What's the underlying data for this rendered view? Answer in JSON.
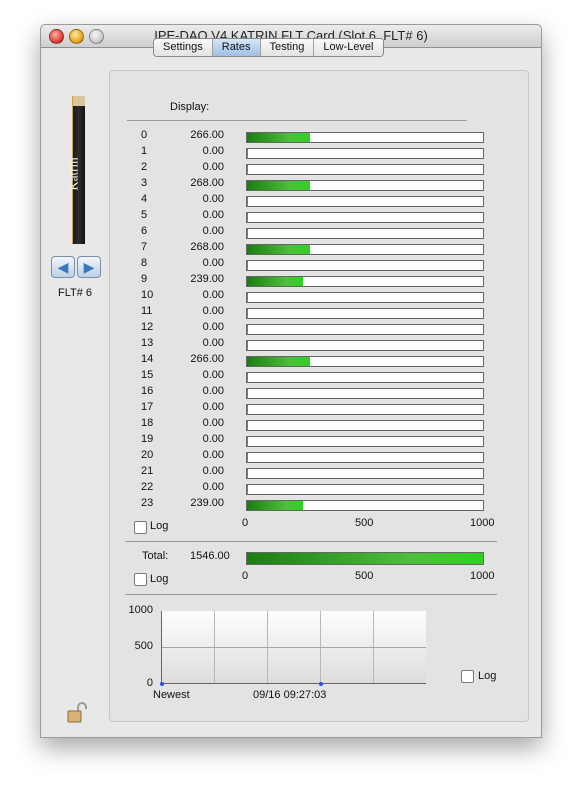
{
  "window": {
    "title": "IPE-DAQ V4 KATRIN FLT Card (Slot 6, FLT# 6)"
  },
  "left": {
    "card_text": "Katrin",
    "flt_label": "FLT# 6"
  },
  "tabs": [
    "Settings",
    "Rates",
    "Testing",
    "Low-Level"
  ],
  "active_tab": "Rates",
  "display_label": "Display:",
  "rate_scale_max": 1000,
  "channels": [
    {
      "ch": "0",
      "val": "266.00",
      "rate": 266
    },
    {
      "ch": "1",
      "val": "0.00",
      "rate": 0
    },
    {
      "ch": "2",
      "val": "0.00",
      "rate": 0
    },
    {
      "ch": "3",
      "val": "268.00",
      "rate": 268
    },
    {
      "ch": "4",
      "val": "0.00",
      "rate": 0
    },
    {
      "ch": "5",
      "val": "0.00",
      "rate": 0
    },
    {
      "ch": "6",
      "val": "0.00",
      "rate": 0
    },
    {
      "ch": "7",
      "val": "268.00",
      "rate": 268
    },
    {
      "ch": "8",
      "val": "0.00",
      "rate": 0
    },
    {
      "ch": "9",
      "val": "239.00",
      "rate": 239
    },
    {
      "ch": "10",
      "val": "0.00",
      "rate": 0
    },
    {
      "ch": "11",
      "val": "0.00",
      "rate": 0
    },
    {
      "ch": "12",
      "val": "0.00",
      "rate": 0
    },
    {
      "ch": "13",
      "val": "0.00",
      "rate": 0
    },
    {
      "ch": "14",
      "val": "266.00",
      "rate": 266
    },
    {
      "ch": "15",
      "val": "0.00",
      "rate": 0
    },
    {
      "ch": "16",
      "val": "0.00",
      "rate": 0
    },
    {
      "ch": "17",
      "val": "0.00",
      "rate": 0
    },
    {
      "ch": "18",
      "val": "0.00",
      "rate": 0
    },
    {
      "ch": "19",
      "val": "0.00",
      "rate": 0
    },
    {
      "ch": "20",
      "val": "0.00",
      "rate": 0
    },
    {
      "ch": "21",
      "val": "0.00",
      "rate": 0
    },
    {
      "ch": "22",
      "val": "0.00",
      "rate": 0
    },
    {
      "ch": "23",
      "val": "239.00",
      "rate": 239
    }
  ],
  "axis_ticks": [
    "0",
    "500",
    "1000"
  ],
  "log_label": "Log",
  "total": {
    "label": "Total:",
    "value": "1546.00",
    "scale_max": 1000,
    "fill": 1.0
  },
  "timeplot": {
    "y_ticks": [
      "1000",
      "500",
      "0"
    ],
    "x_start": "Newest",
    "x_time": "09/16 09:27:03"
  }
}
